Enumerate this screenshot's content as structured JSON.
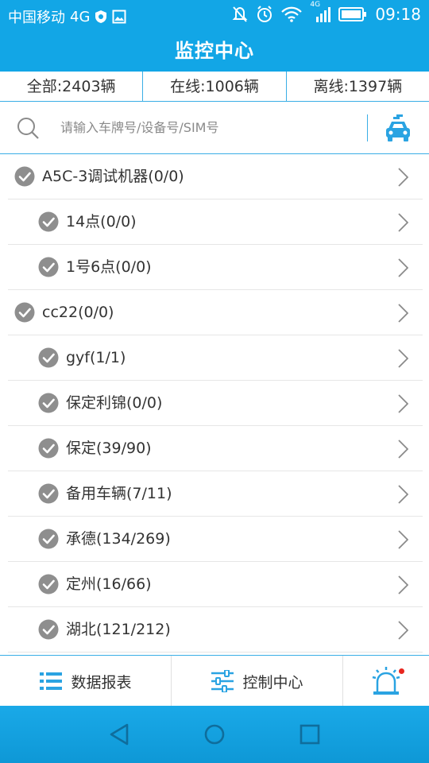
{
  "statusbar": {
    "carrier": "中国移动",
    "network": "4G",
    "signal_tag": "4G",
    "time": "09:18",
    "icons": [
      "shield-icon",
      "image-icon",
      "mute-icon",
      "alarm-icon",
      "wifi-icon",
      "signal-icon",
      "battery-icon"
    ]
  },
  "header": {
    "title": "监控中心"
  },
  "stats": {
    "all": "全部:2403辆",
    "online": "在线:1006辆",
    "offline": "离线:1397辆"
  },
  "search": {
    "placeholder": "请输入车牌号/设备号/SIM号",
    "value": ""
  },
  "list": {
    "items": [
      {
        "label": "A5C-3调试机器(0/0)",
        "level": 0
      },
      {
        "label": "14点(0/0)",
        "level": 1
      },
      {
        "label": "1号6点(0/0)",
        "level": 1
      },
      {
        "label": "cc22(0/0)",
        "level": 0
      },
      {
        "label": "gyf(1/1)",
        "level": 1
      },
      {
        "label": "保定利锦(0/0)",
        "level": 1
      },
      {
        "label": "保定(39/90)",
        "level": 1
      },
      {
        "label": "备用车辆(7/11)",
        "level": 1
      },
      {
        "label": "承德(134/269)",
        "level": 1
      },
      {
        "label": "定州(16/66)",
        "level": 1
      },
      {
        "label": "湖北(121/212)",
        "level": 1
      }
    ]
  },
  "tabs": {
    "report": "数据报表",
    "control": "控制中心",
    "alarm_badge": "red-dot"
  },
  "colors": {
    "primary": "#12a6e6",
    "check": "#8e8e8e",
    "divider": "#3aaee6",
    "badge": "#e8261e"
  }
}
